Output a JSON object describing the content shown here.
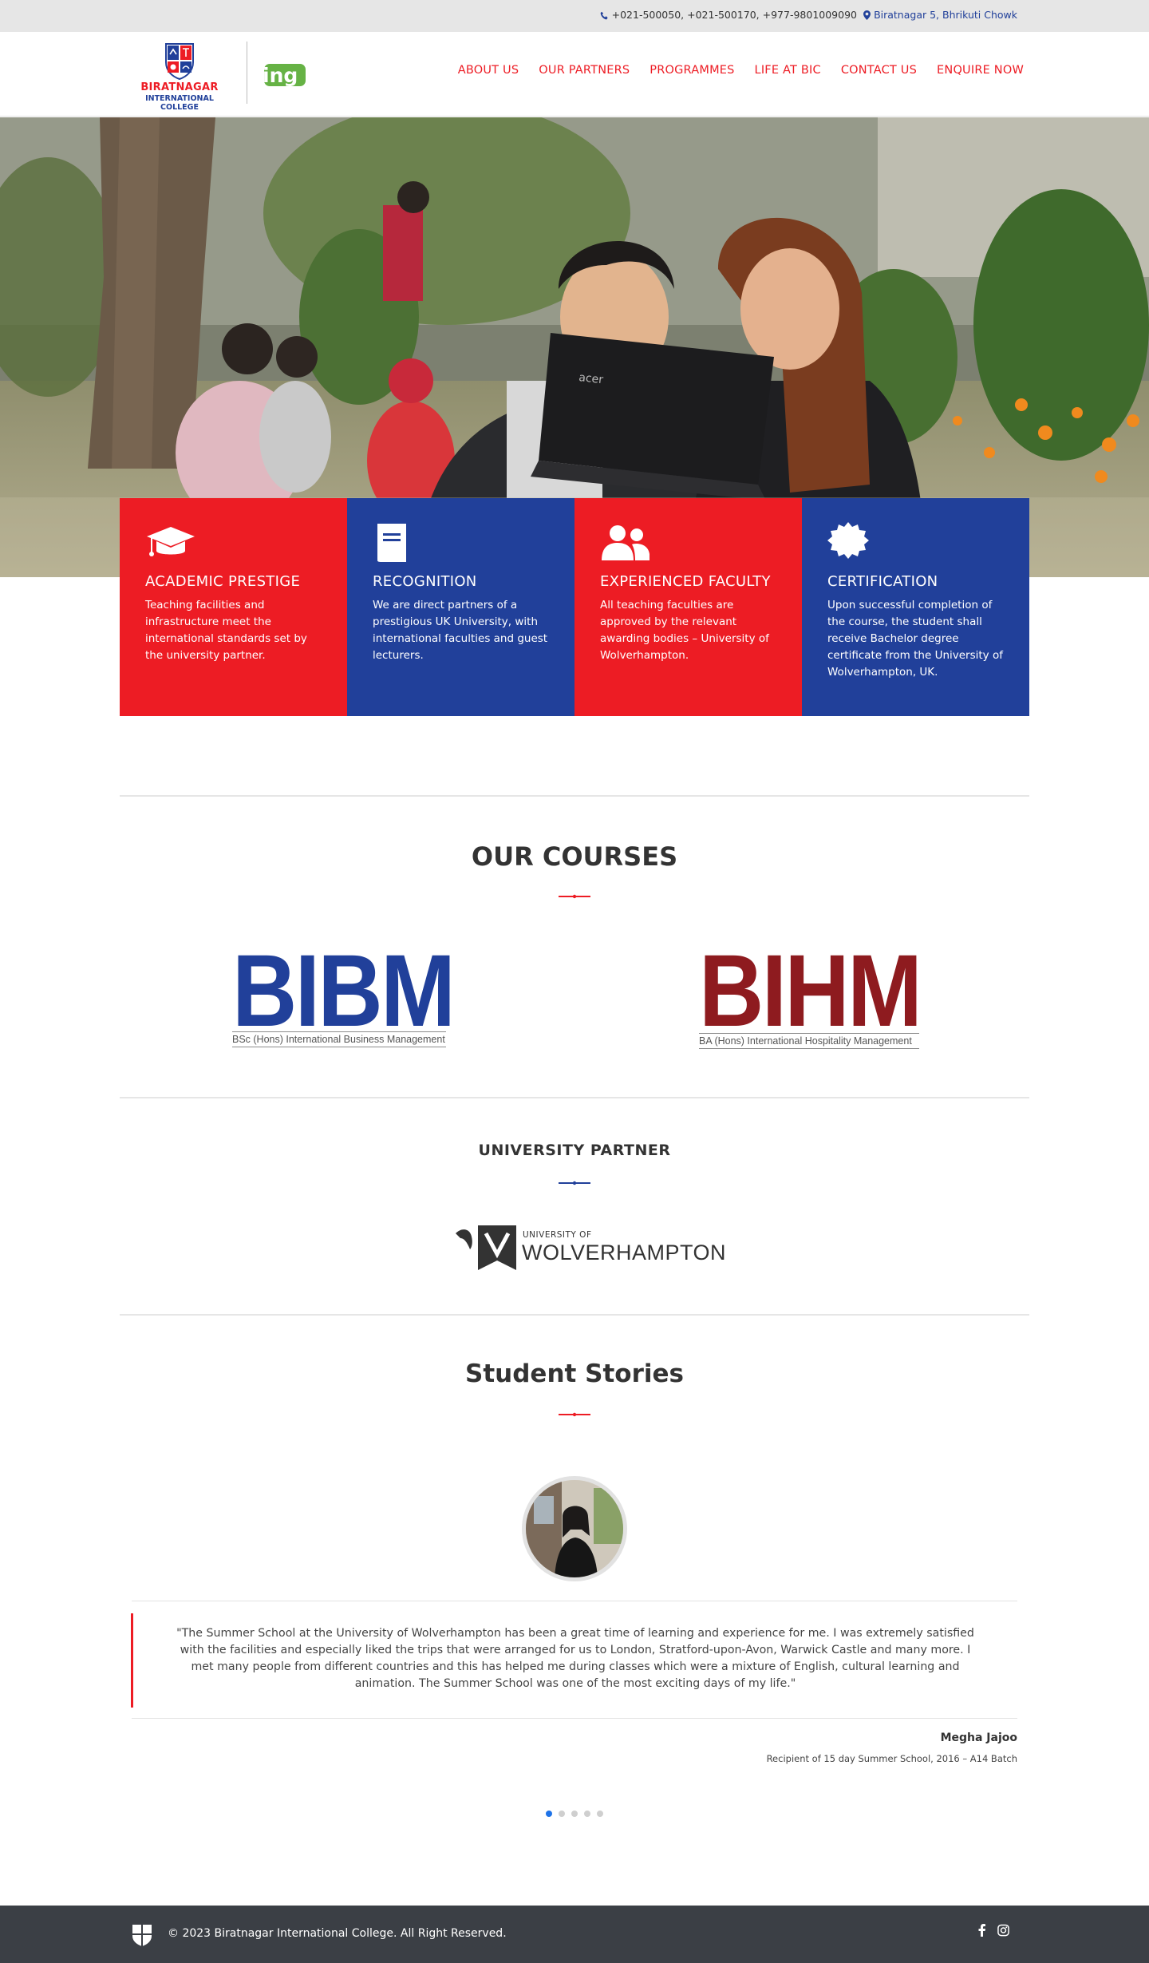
{
  "topbar": {
    "phone": "+021-500050, +021-500170, +977-9801009090",
    "address": "Biratnagar 5, Bhrikuti Chowk"
  },
  "brand": {
    "name_line1": "BIRATNAGAR",
    "name_line2": "INTERNATIONAL COLLEGE",
    "partner_logo_text": "ing"
  },
  "nav": {
    "items": [
      {
        "label": "ABOUT US"
      },
      {
        "label": "OUR PARTNERS"
      },
      {
        "label": "PROGRAMMES"
      },
      {
        "label": "LIFE AT BIC"
      },
      {
        "label": "CONTACT US"
      },
      {
        "label": "ENQUIRE NOW"
      }
    ]
  },
  "features": [
    {
      "icon": "graduation-cap-icon",
      "title": "ACADEMIC PRESTIGE",
      "text": "Teaching facilities and infrastructure meet the international standards set by the university partner."
    },
    {
      "icon": "book-icon",
      "title": "RECOGNITION",
      "text": "We are direct partners of a prestigious UK University, with international faculties and guest lecturers."
    },
    {
      "icon": "users-icon",
      "title": "EXPERIENCED FACULTY",
      "text": "All teaching faculties are approved by the relevant awarding bodies – University of Wolverhampton."
    },
    {
      "icon": "certificate-icon",
      "title": "CERTIFICATION",
      "text": "Upon successful completion of the course, the student shall receive Bachelor degree certificate from the University of Wolverhampton, UK."
    }
  ],
  "courses": {
    "title": "OUR COURSES",
    "items": [
      {
        "name": "BIBM",
        "subtitle": "BSc (Hons) International Business Management"
      },
      {
        "name": "BIHM",
        "subtitle": "BA (Hons) International Hospitality Management"
      }
    ]
  },
  "partner": {
    "title": "UNIVERSITY PARTNER",
    "logo_small": "UNIVERSITY OF",
    "logo_big": "WOLVERHAMPTON"
  },
  "stories": {
    "title": "Student Stories",
    "quote": "\"The Summer School at the University of Wolverhampton has been a great time of learning and experience for me. I was extremely satisfied with the facilities and especially liked the trips that were arranged for us to London, Stratford-upon-Avon, Warwick Castle and many more. I met many people from different countries and this has helped me during classes which were a mixture of English, cultural learning and animation. The Summer School was one of the most exciting days of my life.\"",
    "name": "Megha Jajoo",
    "role": "Recipient of 15 day Summer School, 2016 – A14 Batch",
    "slide_count": 5,
    "active_slide": 1
  },
  "footer": {
    "copyright": "© 2023 Biratnagar International College. All Right Reserved.",
    "social": [
      "facebook-icon",
      "instagram-icon"
    ]
  },
  "colors": {
    "brand_red": "#ed1c24",
    "brand_blue": "#21409a",
    "course_red": "#8e1b1f",
    "footer_bg": "#3b3f45"
  }
}
